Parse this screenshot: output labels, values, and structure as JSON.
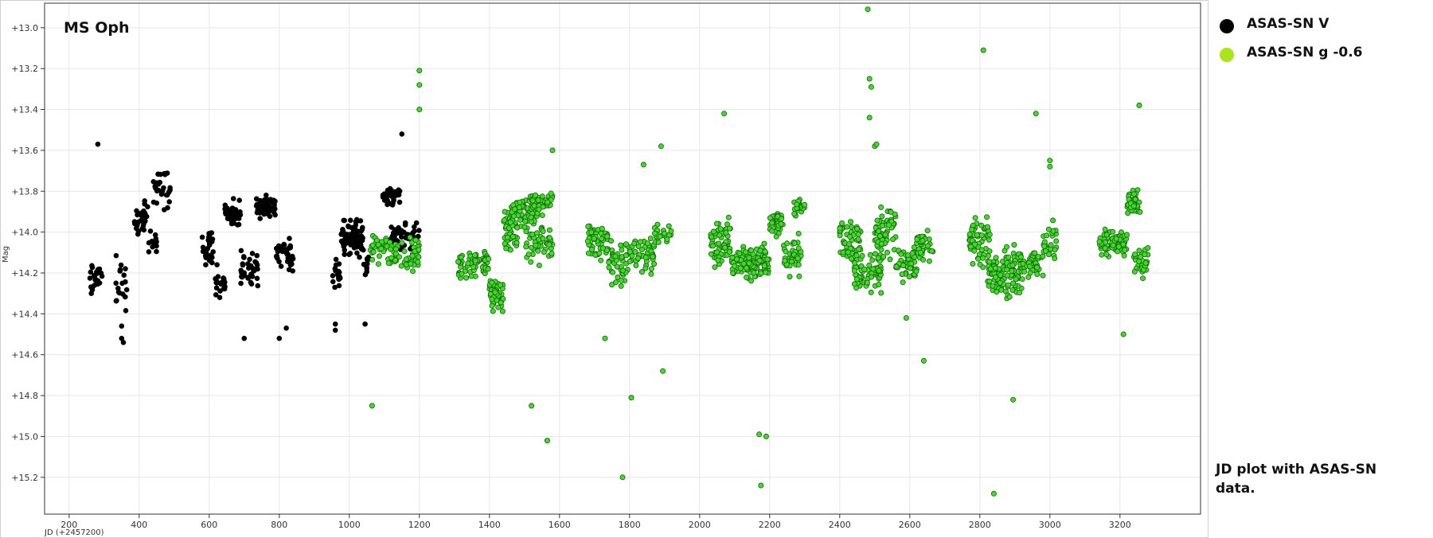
{
  "chart_data": {
    "type": "scatter",
    "title": "MS Oph",
    "xlabel": "JD (+2457200)",
    "ylabel": "Mag",
    "xlim": [
      130,
      3430
    ],
    "ylim": [
      15.38,
      12.88
    ],
    "y_inverted": true,
    "x_ticks": [
      200,
      400,
      600,
      800,
      1000,
      1200,
      1400,
      1600,
      1800,
      2000,
      2200,
      2400,
      2600,
      2800,
      3000,
      3200
    ],
    "y_ticks": [
      13.0,
      13.2,
      13.4,
      13.6,
      13.8,
      14.0,
      14.2,
      14.4,
      14.6,
      14.8,
      15.0,
      15.2
    ],
    "y_tick_prefix": "+",
    "grid": true,
    "legend_position": "right",
    "series": [
      {
        "name": "ASAS-SN V",
        "color": "#000000",
        "edge": "#000000",
        "segments": [
          {
            "x0": 255,
            "x1": 295,
            "y": 14.22,
            "spread": 0.12,
            "n": 26
          },
          {
            "x0": 330,
            "x1": 375,
            "y": 14.25,
            "spread": 0.18,
            "n": 18
          },
          {
            "x0": 385,
            "x1": 425,
            "y": 13.93,
            "spread": 0.12,
            "n": 30
          },
          {
            "x0": 425,
            "x1": 450,
            "y": 14.05,
            "spread": 0.08,
            "n": 12
          },
          {
            "x0": 440,
            "x1": 490,
            "y": 13.8,
            "spread": 0.13,
            "n": 30
          },
          {
            "x0": 580,
            "x1": 615,
            "y": 14.08,
            "spread": 0.13,
            "n": 30
          },
          {
            "x0": 615,
            "x1": 645,
            "y": 14.24,
            "spread": 0.1,
            "n": 22
          },
          {
            "x0": 645,
            "x1": 690,
            "y": 13.92,
            "spread": 0.1,
            "n": 40
          },
          {
            "x0": 690,
            "x1": 740,
            "y": 14.18,
            "spread": 0.13,
            "n": 40
          },
          {
            "x0": 730,
            "x1": 790,
            "y": 13.88,
            "spread": 0.07,
            "n": 55
          },
          {
            "x0": 790,
            "x1": 840,
            "y": 14.12,
            "spread": 0.11,
            "n": 36
          },
          {
            "x0": 950,
            "x1": 975,
            "y": 14.2,
            "spread": 0.11,
            "n": 18
          },
          {
            "x0": 975,
            "x1": 1040,
            "y": 14.03,
            "spread": 0.12,
            "n": 80
          },
          {
            "x0": 1040,
            "x1": 1060,
            "y": 14.18,
            "spread": 0.08,
            "n": 10
          },
          {
            "x0": 1095,
            "x1": 1145,
            "y": 13.82,
            "spread": 0.06,
            "n": 35
          },
          {
            "x0": 1115,
            "x1": 1200,
            "y": 14.02,
            "spread": 0.09,
            "n": 50
          }
        ],
        "points": [
          [
            282,
            13.57
          ],
          [
            350,
            14.52
          ],
          [
            350,
            14.46
          ],
          [
            355,
            14.54
          ],
          [
            1150,
            13.52
          ],
          [
            1045,
            14.45
          ],
          [
            960,
            14.45
          ],
          [
            960,
            14.48
          ],
          [
            820,
            14.47
          ],
          [
            800,
            14.52
          ],
          [
            700,
            14.52
          ]
        ]
      },
      {
        "name": "ASAS-SN g -0.6",
        "color": "#3fdc2a",
        "edge": "#1b5e0c",
        "legend_color": "#a8e51b",
        "segments": [
          {
            "x0": 1060,
            "x1": 1110,
            "y": 14.07,
            "spread": 0.1,
            "n": 30
          },
          {
            "x0": 1110,
            "x1": 1200,
            "y": 14.1,
            "spread": 0.12,
            "n": 55
          },
          {
            "x0": 1310,
            "x1": 1400,
            "y": 14.15,
            "spread": 0.1,
            "n": 70
          },
          {
            "x0": 1400,
            "x1": 1440,
            "y": 14.3,
            "spread": 0.13,
            "n": 45
          },
          {
            "x0": 1440,
            "x1": 1480,
            "y": 14.0,
            "spread": 0.16,
            "n": 45
          },
          {
            "x0": 1460,
            "x1": 1540,
            "y": 13.9,
            "spread": 0.11,
            "n": 60
          },
          {
            "x0": 1500,
            "x1": 1580,
            "y": 14.05,
            "spread": 0.13,
            "n": 50
          },
          {
            "x0": 1520,
            "x1": 1580,
            "y": 13.85,
            "spread": 0.08,
            "n": 40
          },
          {
            "x0": 1680,
            "x1": 1740,
            "y": 14.05,
            "spread": 0.12,
            "n": 55
          },
          {
            "x0": 1740,
            "x1": 1800,
            "y": 14.15,
            "spread": 0.15,
            "n": 45
          },
          {
            "x0": 1800,
            "x1": 1870,
            "y": 14.12,
            "spread": 0.14,
            "n": 45
          },
          {
            "x0": 1870,
            "x1": 1920,
            "y": 14.02,
            "spread": 0.1,
            "n": 25
          },
          {
            "x0": 2030,
            "x1": 2090,
            "y": 14.05,
            "spread": 0.17,
            "n": 65
          },
          {
            "x0": 2090,
            "x1": 2200,
            "y": 14.15,
            "spread": 0.12,
            "n": 120
          },
          {
            "x0": 2200,
            "x1": 2240,
            "y": 13.95,
            "spread": 0.09,
            "n": 35
          },
          {
            "x0": 2240,
            "x1": 2290,
            "y": 14.12,
            "spread": 0.13,
            "n": 40
          },
          {
            "x0": 2270,
            "x1": 2300,
            "y": 13.88,
            "spread": 0.08,
            "n": 20
          },
          {
            "x0": 2400,
            "x1": 2460,
            "y": 14.05,
            "spread": 0.16,
            "n": 55
          },
          {
            "x0": 2440,
            "x1": 2520,
            "y": 14.2,
            "spread": 0.12,
            "n": 70
          },
          {
            "x0": 2500,
            "x1": 2560,
            "y": 14.0,
            "spread": 0.17,
            "n": 70
          },
          {
            "x0": 2560,
            "x1": 2620,
            "y": 14.15,
            "spread": 0.13,
            "n": 50
          },
          {
            "x0": 2620,
            "x1": 2670,
            "y": 14.08,
            "spread": 0.1,
            "n": 35
          },
          {
            "x0": 2770,
            "x1": 2830,
            "y": 14.05,
            "spread": 0.17,
            "n": 55
          },
          {
            "x0": 2820,
            "x1": 2870,
            "y": 14.22,
            "spread": 0.14,
            "n": 55
          },
          {
            "x0": 2870,
            "x1": 2920,
            "y": 14.2,
            "spread": 0.18,
            "n": 60
          },
          {
            "x0": 2920,
            "x1": 2980,
            "y": 14.15,
            "spread": 0.1,
            "n": 45
          },
          {
            "x0": 2980,
            "x1": 3020,
            "y": 14.05,
            "spread": 0.15,
            "n": 25
          },
          {
            "x0": 3140,
            "x1": 3220,
            "y": 14.05,
            "spread": 0.08,
            "n": 80
          },
          {
            "x0": 3220,
            "x1": 3260,
            "y": 13.85,
            "spread": 0.09,
            "n": 40
          },
          {
            "x0": 3240,
            "x1": 3280,
            "y": 14.15,
            "spread": 0.15,
            "n": 30
          }
        ],
        "points": [
          [
            1200,
            13.21
          ],
          [
            1200,
            13.28
          ],
          [
            1200,
            13.4
          ],
          [
            1065,
            14.85
          ],
          [
            1520,
            14.85
          ],
          [
            1565,
            15.02
          ],
          [
            1580,
            13.6
          ],
          [
            1780,
            15.2
          ],
          [
            1805,
            14.81
          ],
          [
            1895,
            14.68
          ],
          [
            1890,
            13.58
          ],
          [
            1840,
            13.67
          ],
          [
            2070,
            13.42
          ],
          [
            2170,
            14.99
          ],
          [
            2190,
            15.0
          ],
          [
            2175,
            15.24
          ],
          [
            2480,
            12.91
          ],
          [
            2485,
            13.25
          ],
          [
            2490,
            13.29
          ],
          [
            2485,
            13.44
          ],
          [
            2500,
            13.58
          ],
          [
            2505,
            13.57
          ],
          [
            2640,
            14.63
          ],
          [
            2810,
            13.11
          ],
          [
            2840,
            15.28
          ],
          [
            2895,
            14.82
          ],
          [
            2960,
            13.42
          ],
          [
            3000,
            13.65
          ],
          [
            3000,
            13.68
          ],
          [
            3210,
            14.5
          ],
          [
            3255,
            13.38
          ],
          [
            2590,
            14.42
          ],
          [
            1730,
            14.52
          ]
        ]
      }
    ]
  },
  "note": "JD plot with ASAS-SN data."
}
